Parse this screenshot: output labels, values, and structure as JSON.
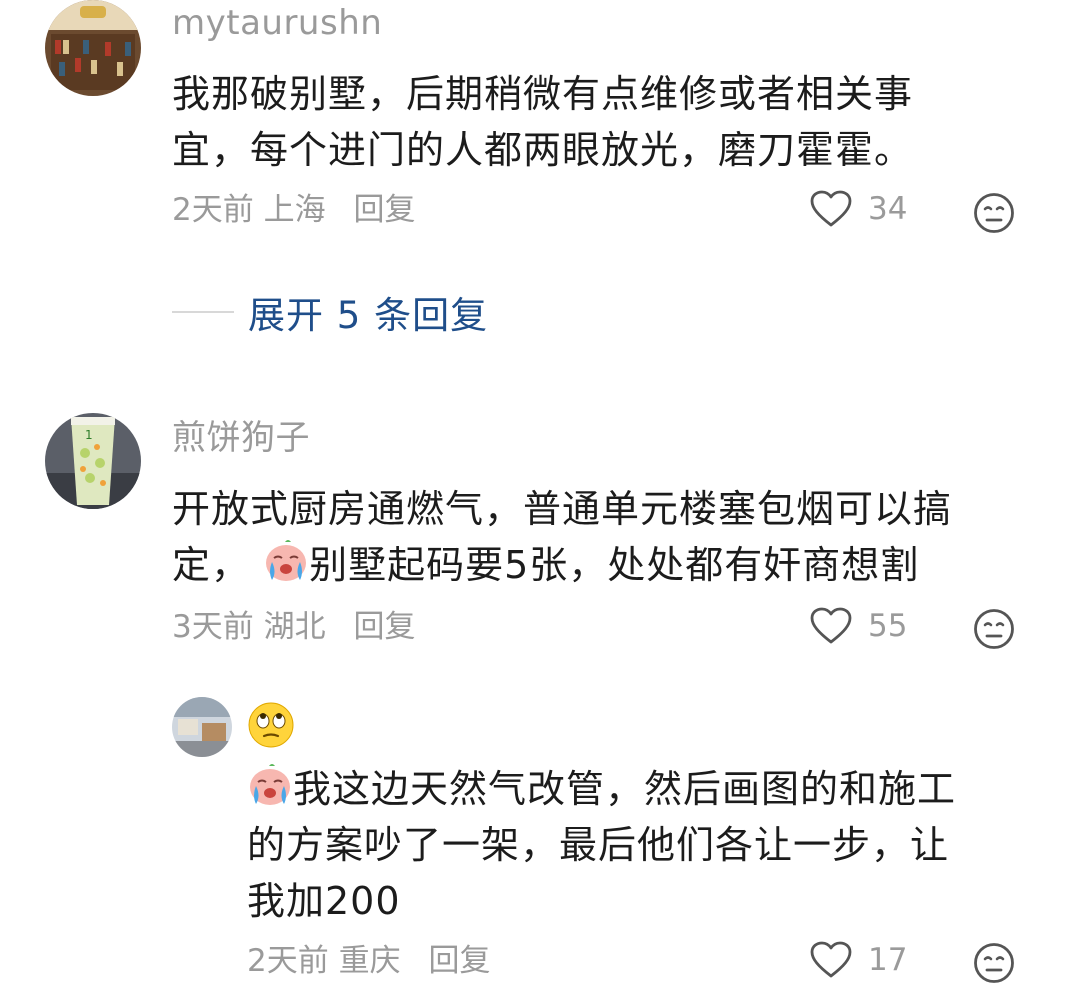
{
  "comments": [
    {
      "username": "mytaurushn",
      "text_line1": "我那破别墅，后期稍微有点维修或者相关事",
      "text_line2": "宜，每个进门的人都两眼放光，磨刀霍霍。",
      "time": "2天前",
      "location": "上海",
      "reply_label": "回复",
      "likes": "34",
      "expand_label": "展开 5 条回复"
    },
    {
      "username": "煎饼狗子",
      "text_line1": "开放式厨房通燃气，普通单元楼塞包烟可以搞",
      "text_line2_a": "定，",
      "text_line2_b": "别墅起码要5张，处处都有奸商想割",
      "time": "3天前",
      "location": "湖北",
      "reply_label": "回复",
      "likes": "55"
    },
    {
      "username_emoji": "eye-roll-emoji",
      "text_line1": "我这边天然气改管，然后画图的和施工",
      "text_line2": "的方案吵了一架，最后他们各让一步，让",
      "text_line3": "我加200",
      "time": "2天前",
      "location": "重庆",
      "reply_label": "回复",
      "likes": "17"
    }
  ],
  "colors": {
    "meta_gray": "#9a9a9a",
    "expand_blue": "#1f4e8a",
    "text": "#1c1c1c"
  },
  "icons": [
    "heart-outline-icon",
    "neutral-face-icon",
    "crying-emoji",
    "eye-roll-emoji"
  ]
}
